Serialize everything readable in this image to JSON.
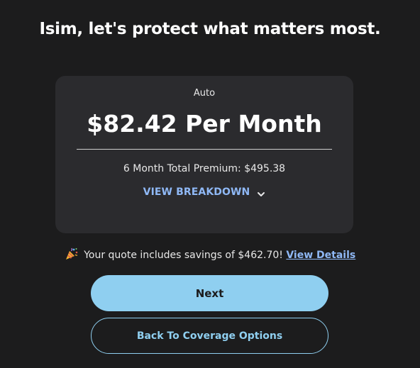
{
  "header": {
    "headline": "Isim, let's protect what matters most."
  },
  "quote": {
    "product": "Auto",
    "monthly_price": "$82.42 Per Month",
    "total_premium": "6 Month Total Premium: $495.38",
    "breakdown_label": "VIEW BREAKDOWN",
    "breakdown_icon": "chevron-down-icon"
  },
  "savings": {
    "icon": "party-popper-icon",
    "text": "Your quote includes savings of $462.70!",
    "link_label": "View Details"
  },
  "actions": {
    "next_label": "Next",
    "back_label": "Back To Coverage Options"
  },
  "colors": {
    "background": "#1c1c1d",
    "card": "#2b2b2e",
    "link": "#8fb8f5",
    "primary_button": "#8fcff0"
  }
}
